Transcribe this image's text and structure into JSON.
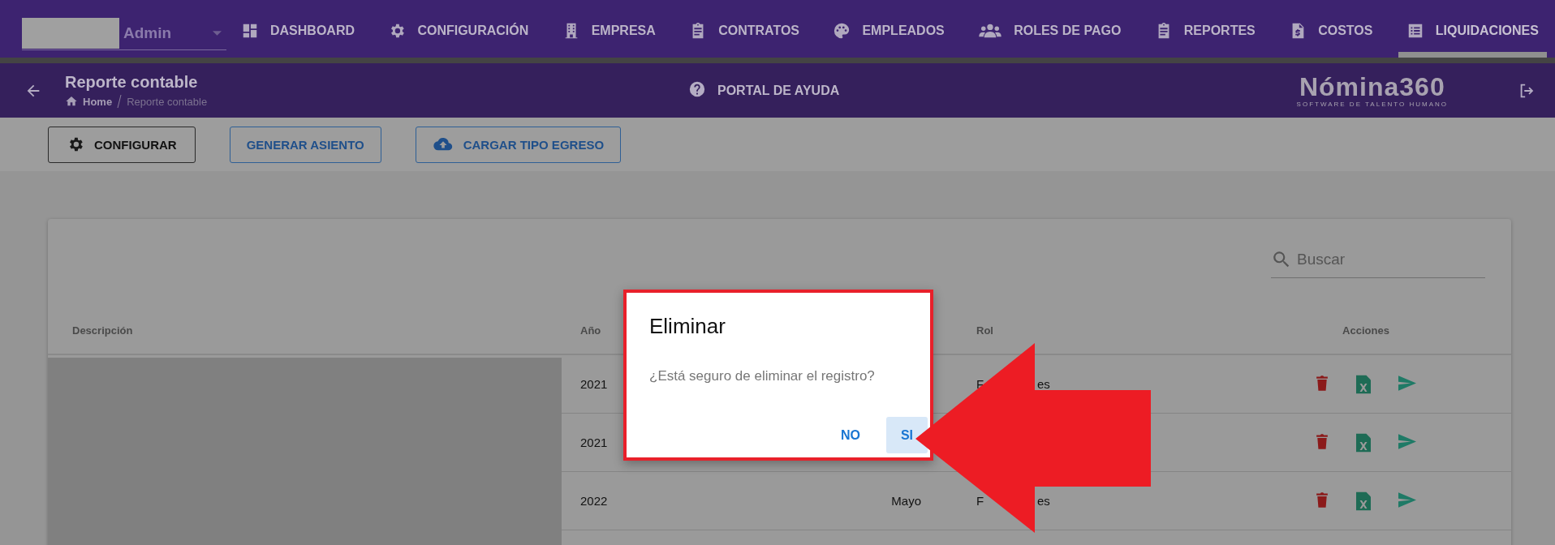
{
  "nav": {
    "user": "Admin",
    "tabs": [
      {
        "label": "DASHBOARD",
        "selected": false
      },
      {
        "label": "CONFIGURACIÓN",
        "selected": false
      },
      {
        "label": "EMPRESA",
        "selected": false
      },
      {
        "label": "CONTRATOS",
        "selected": false
      },
      {
        "label": "EMPLEADOS",
        "selected": false
      },
      {
        "label": "ROLES DE PAGO",
        "selected": false
      },
      {
        "label": "REPORTES",
        "selected": false
      },
      {
        "label": "COSTOS",
        "selected": false
      },
      {
        "label": "LIQUIDACIONES",
        "selected": true
      }
    ]
  },
  "header": {
    "title": "Reporte contable",
    "breadcrumb": [
      "Home",
      "Reporte contable"
    ],
    "help": "PORTAL DE AYUDA",
    "logo": {
      "name": "Nómina360",
      "tagline": "SOFTWARE DE TALENTO HUMANO"
    }
  },
  "toolbar": {
    "buttons": [
      {
        "label": "CONFIGURAR",
        "kind": "dark"
      },
      {
        "label": "GENERAR ASIENTO",
        "kind": "outlined"
      },
      {
        "label": "CARGAR TIPO EGRESO",
        "kind": "outlined"
      }
    ]
  },
  "table": {
    "search": {
      "placeholder": "Buscar"
    },
    "columns": [
      "Descripción",
      "Año",
      "Rol",
      "Acciones"
    ],
    "rows": [
      {
        "year": "2021",
        "role": [
          "F",
          "es"
        ]
      },
      {
        "year": "2021"
      },
      {
        "year": "2022",
        "month": "Mayo",
        "role": [
          "F",
          "es"
        ]
      }
    ]
  },
  "dialog": {
    "title": "Eliminar",
    "message": "¿Está seguro de eliminar el registro?",
    "buttons": [
      {
        "label": "NO",
        "focused": false
      },
      {
        "label": "SI",
        "focused": true
      }
    ]
  }
}
